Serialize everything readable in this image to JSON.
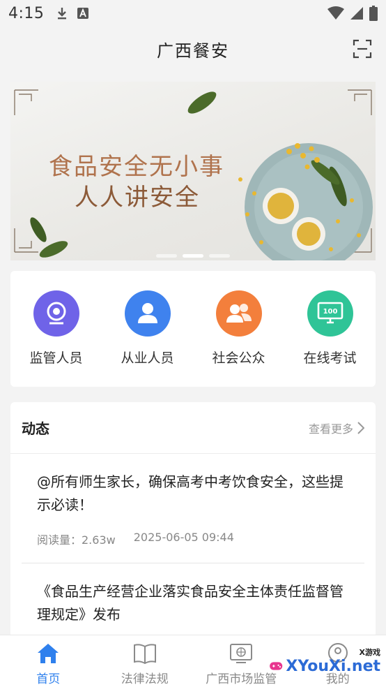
{
  "status_bar": {
    "time": "4:15"
  },
  "header": {
    "title": "广西餐安"
  },
  "banner": {
    "line1": "食品安全无小事",
    "line2": "人人讲安全",
    "slide_count": 3,
    "active_slide": 2
  },
  "categories": [
    {
      "label": "监管人员",
      "icon": "camera-icon",
      "color": "#6f63e8"
    },
    {
      "label": "从业人员",
      "icon": "person-icon",
      "color": "#3f82ee"
    },
    {
      "label": "社会公众",
      "icon": "group-icon",
      "color": "#f37f3c"
    },
    {
      "label": "在线考试",
      "icon": "exam-screen-icon",
      "color": "#2fc497"
    }
  ],
  "news": {
    "title": "动态",
    "more_label": "查看更多",
    "items": [
      {
        "title": "@所有师生家长，确保高考中考饮食安全，这些提示必读！",
        "reads": "阅读量：2.63w",
        "date": "2025-06-05 09:44"
      },
      {
        "title": "《食品生产经营企业落实食品安全主体责任监督管理规定》发布"
      }
    ]
  },
  "bottom_nav": {
    "items": [
      {
        "label": "首页",
        "icon": "home-icon",
        "active": true
      },
      {
        "label": "法律法规",
        "icon": "book-icon",
        "active": false
      },
      {
        "label": "广西市场监管",
        "icon": "monitor-globe-icon",
        "active": false
      },
      {
        "label": "我的",
        "icon": "profile-icon",
        "active": false
      }
    ]
  },
  "watermark": {
    "text": "XYouXi.net",
    "small": "X游戏"
  },
  "colors": {
    "accent": "#2f80ed",
    "background": "#f3f3f3"
  }
}
